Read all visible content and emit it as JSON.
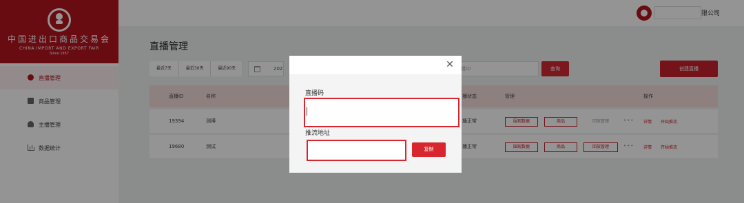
{
  "sidebar": {
    "brand_cn": "中国进出口商品交易会",
    "brand_en": "CHINA IMPORT AND EXPORT FAIR",
    "brand_since": "Since 1957",
    "items": [
      {
        "label": "直播管理",
        "icon": "live-icon"
      },
      {
        "label": "商品管理",
        "icon": "doc-icon"
      },
      {
        "label": "主播管理",
        "icon": "user-icon"
      },
      {
        "label": "数据统计",
        "icon": "bar-chart-icon"
      }
    ]
  },
  "topbar": {
    "company_suffix": "限公司"
  },
  "main": {
    "title": "直播管理",
    "filters": [
      "最近7天",
      "最近30天",
      "最近90天"
    ],
    "date_value": "202",
    "search_placeholder": "播ID",
    "search_label": "查询",
    "create_label": "创建直播",
    "table": {
      "headers": {
        "id": "直播ID",
        "name": "名称",
        "status": "播状态",
        "manage": "管理",
        "ops": "操作"
      },
      "rows": [
        {
          "id": "19394",
          "name": "测博",
          "status": "播正常",
          "btn_data": "围观数据",
          "btn_goods": "商品",
          "btn_third": "回放管理",
          "dots": "•••",
          "link_detail": "详情",
          "link_start": "开始推流"
        },
        {
          "id": "19680",
          "name": "测试",
          "status": "播正常",
          "btn_data": "围观数据",
          "btn_goods": "商品",
          "btn_third": "回放管理",
          "dots": "•••",
          "link_detail": "详情",
          "link_start": "开始推流"
        }
      ]
    }
  },
  "modal": {
    "close_symbol": "✕",
    "code_label": "直播码",
    "url_label": "推流地址",
    "copy_label": "复制"
  },
  "colors": {
    "brand": "#b5151f",
    "accent": "#d7262e"
  }
}
